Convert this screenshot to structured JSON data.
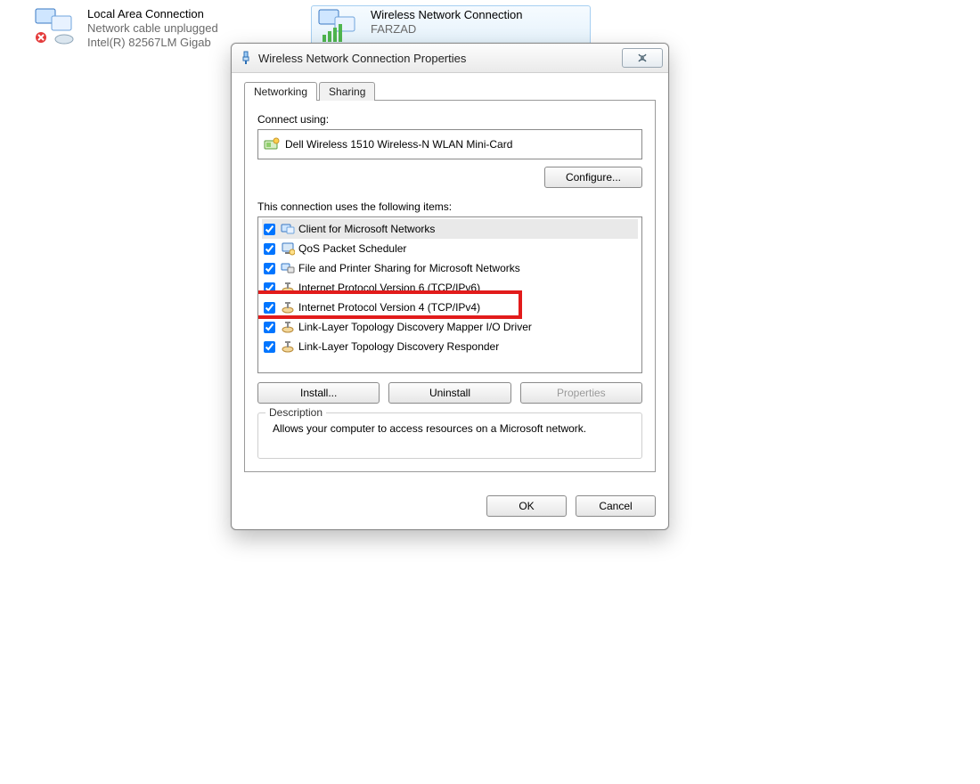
{
  "background": {
    "lan": {
      "title": "Local Area Connection",
      "status": "Network cable unplugged",
      "adapter": "Intel(R) 82567LM Gigab"
    },
    "wlan": {
      "title": "Wireless Network Connection",
      "ssid": "FARZAD"
    }
  },
  "dialog": {
    "title": "Wireless Network Connection Properties",
    "tabs": {
      "networking": "Networking",
      "sharing": "Sharing"
    },
    "connect_using_label": "Connect using:",
    "adapter": "Dell Wireless 1510 Wireless-N WLAN Mini-Card",
    "configure": "Configure...",
    "items_label": "This connection uses the following items:",
    "items": [
      {
        "label": "Client for Microsoft Networks",
        "checked": true,
        "icon": "client",
        "selected": true
      },
      {
        "label": "QoS Packet Scheduler",
        "checked": true,
        "icon": "qos"
      },
      {
        "label": "File and Printer Sharing for Microsoft Networks",
        "checked": true,
        "icon": "fps"
      },
      {
        "label": "Internet Protocol Version 6 (TCP/IPv6)",
        "checked": true,
        "icon": "proto"
      },
      {
        "label": "Internet Protocol Version 4 (TCP/IPv4)",
        "checked": true,
        "icon": "proto",
        "highlight": true
      },
      {
        "label": "Link-Layer Topology Discovery Mapper I/O Driver",
        "checked": true,
        "icon": "proto"
      },
      {
        "label": "Link-Layer Topology Discovery Responder",
        "checked": true,
        "icon": "proto"
      }
    ],
    "buttons": {
      "install": "Install...",
      "uninstall": "Uninstall",
      "properties": "Properties"
    },
    "description": {
      "legend": "Description",
      "text": "Allows your computer to access resources on a Microsoft network."
    },
    "ok": "OK",
    "cancel": "Cancel"
  }
}
